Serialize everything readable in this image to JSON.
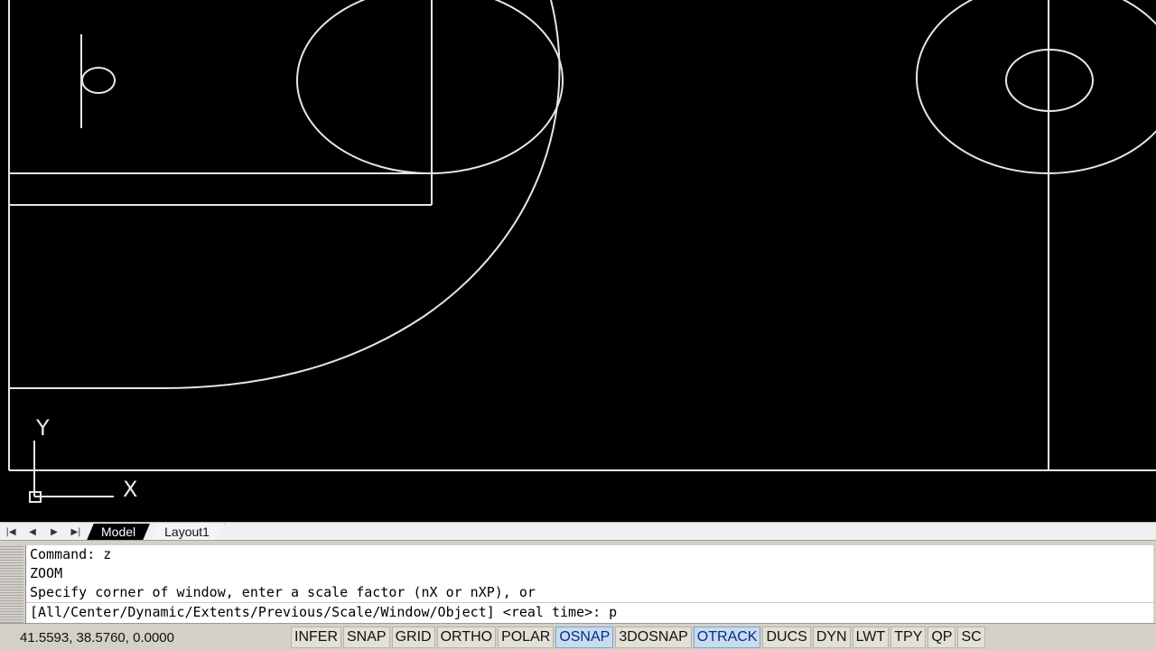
{
  "drawing": {
    "ucs_x_label": "X",
    "ucs_y_label": "Y"
  },
  "tabs": {
    "nav": [
      "first-icon",
      "prev-icon",
      "next-icon",
      "last-icon"
    ],
    "items": [
      {
        "label": "Model",
        "active": true
      },
      {
        "label": "Layout1",
        "active": false
      }
    ]
  },
  "command": {
    "lines": [
      "Command: z",
      "ZOOM",
      "Specify corner of window, enter a scale factor (nX or nXP), or",
      "[All/Center/Dynamic/Extents/Previous/Scale/Window/Object] <real time>: p"
    ]
  },
  "status": {
    "coordinates": "41.5593, 38.5760, 0.0000",
    "buttons": [
      {
        "label": "INFER",
        "on": false
      },
      {
        "label": "SNAP",
        "on": false
      },
      {
        "label": "GRID",
        "on": false
      },
      {
        "label": "ORTHO",
        "on": false
      },
      {
        "label": "POLAR",
        "on": false
      },
      {
        "label": "OSNAP",
        "on": true
      },
      {
        "label": "3DOSNAP",
        "on": false
      },
      {
        "label": "OTRACK",
        "on": true
      },
      {
        "label": "DUCS",
        "on": false
      },
      {
        "label": "DYN",
        "on": false
      },
      {
        "label": "LWT",
        "on": false
      },
      {
        "label": "TPY",
        "on": false
      },
      {
        "label": "QP",
        "on": false
      },
      {
        "label": "SC",
        "on": false
      }
    ]
  },
  "colors": {
    "canvas_bg": "#000000",
    "line": "#e6e6e6",
    "toggle_on": "#c8dcf0"
  }
}
